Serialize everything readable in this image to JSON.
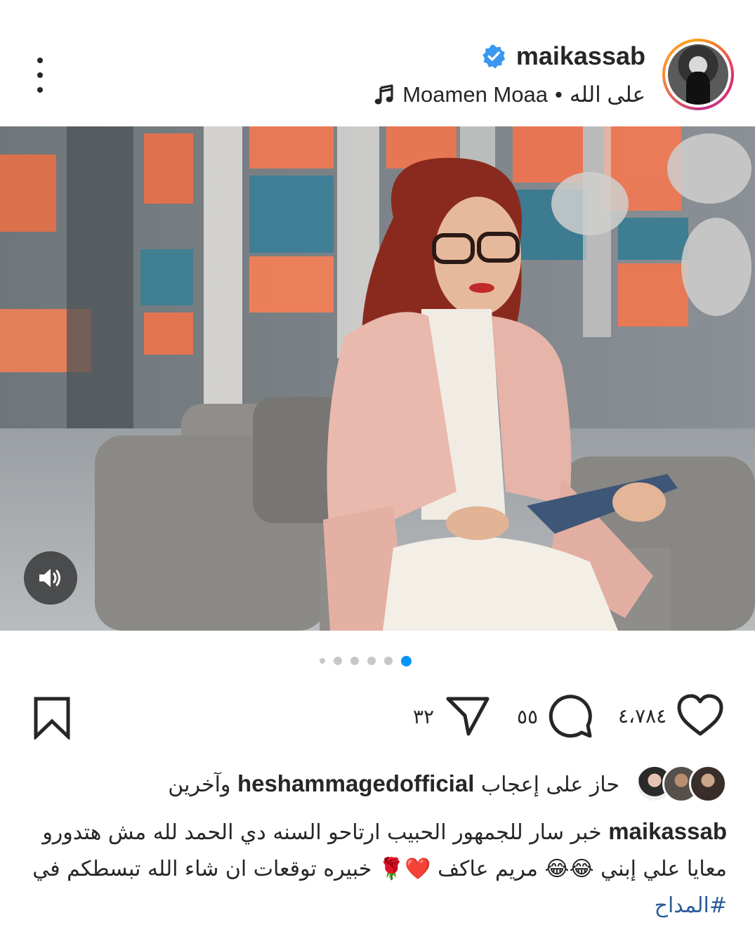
{
  "post": {
    "username": "maikassab",
    "verified": true,
    "audio_artist": "Moamen Moaa",
    "audio_separator": "•",
    "audio_title": "على الله",
    "media_slide_count": 6,
    "media_active_slide": 6
  },
  "actions": {
    "like_count": "٤،٧٨٤",
    "comment_count": "٥٥",
    "share_count": "٣٢"
  },
  "likes": {
    "prefix": "حاز على إعجاب",
    "user": "heshammagedofficial",
    "suffix": "وآخرين"
  },
  "caption": {
    "username": "maikassab",
    "text_part1": "خبر سار للجمهور الحبيب ارتاحو السنه دي الحمد لله مش هتدورو معايا علي إبني",
    "emoji1": "😂😂",
    "text_part2": "مريم عاكف",
    "emoji2": "❤️🌹",
    "text_part3": "خبيره توقعات ان شاء الله تبسطكم في",
    "hashtag": "#المداح"
  },
  "colors": {
    "verified_blue": "#3897f0",
    "hashtag_blue": "#2c5c99",
    "active_dot": "#0095f6",
    "inactive_dot": "#c7c7c7",
    "text": "#262626"
  },
  "icons": {
    "more": "more-vertical-icon",
    "verified": "verified-badge-icon",
    "music": "music-note-icon",
    "sound": "speaker-icon",
    "like": "heart-icon",
    "comment": "comment-icon",
    "share": "paper-plane-icon",
    "save": "bookmark-icon"
  }
}
